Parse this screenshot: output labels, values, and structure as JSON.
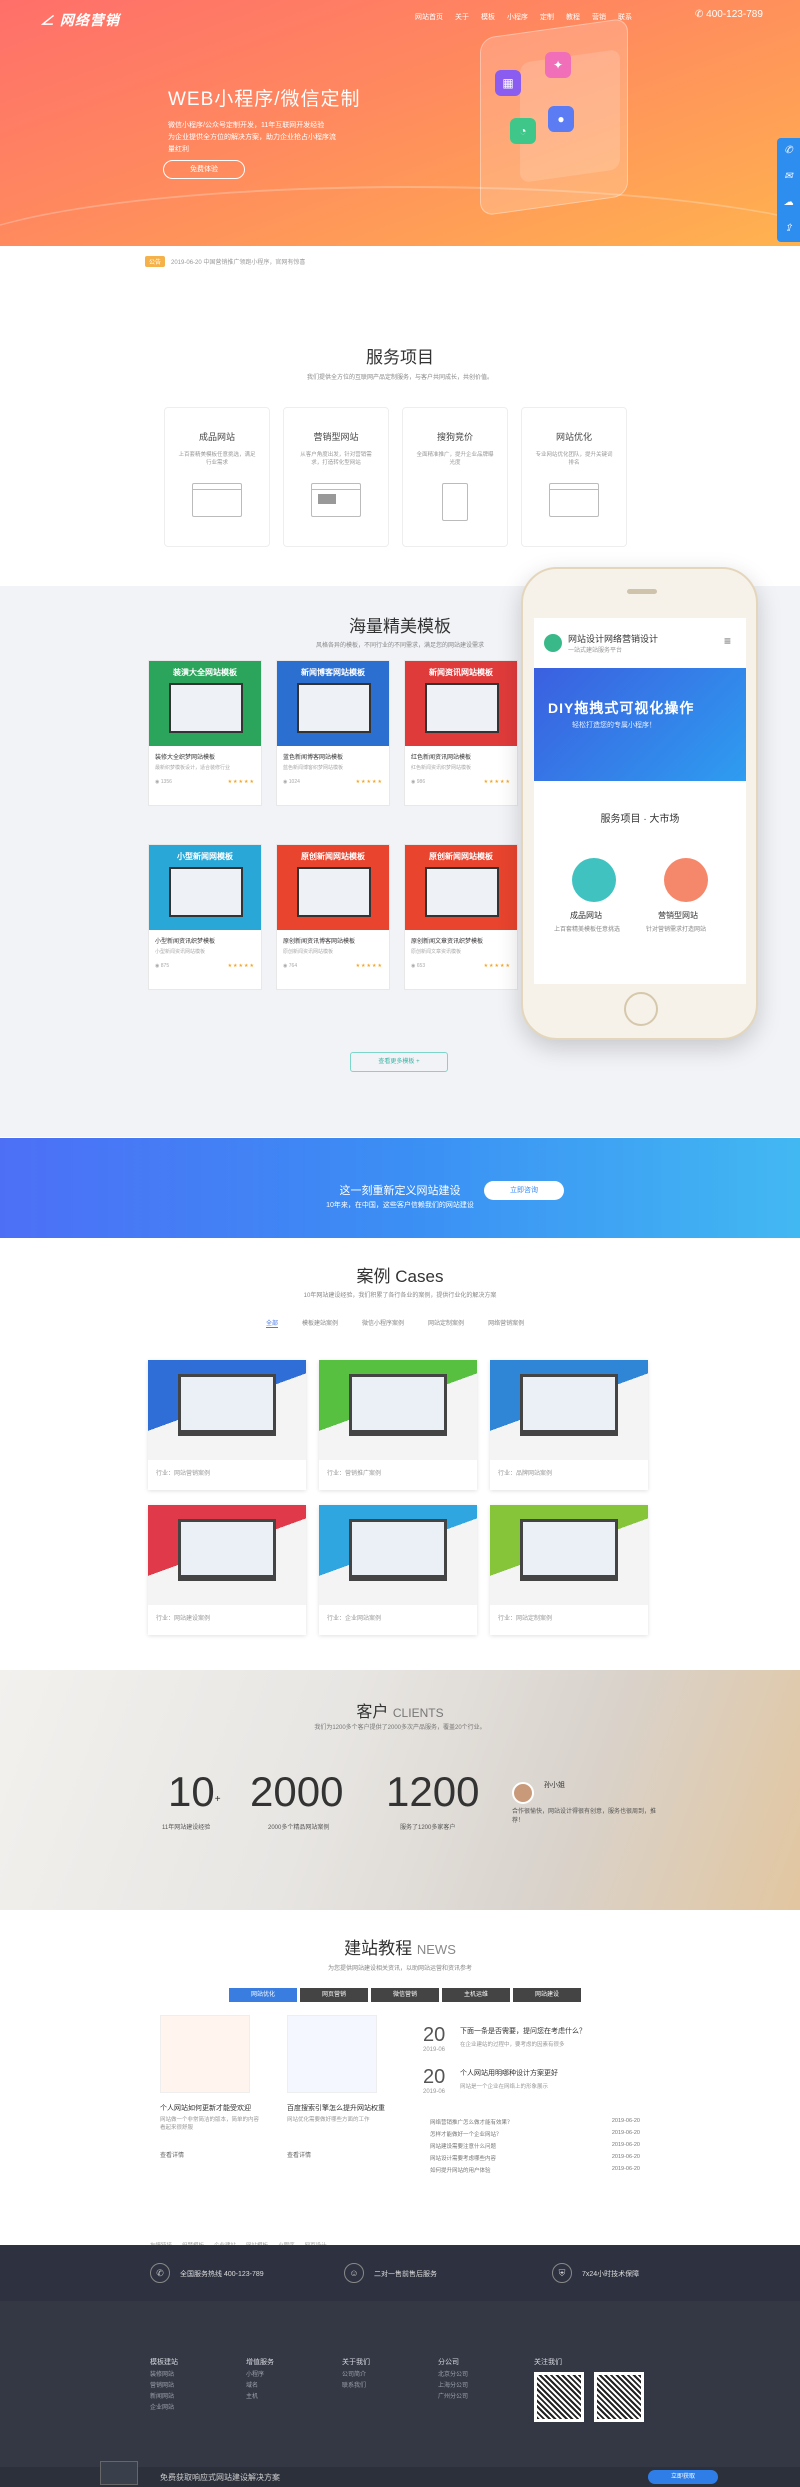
{
  "header": {
    "logo": "网络营销",
    "nav": [
      "网站首页",
      "关于",
      "模板",
      "小程序",
      "定制",
      "教程",
      "营销",
      "联系"
    ],
    "phone": "400-123-789"
  },
  "hero": {
    "title": "WEB小程序/微信定制",
    "desc1": "微信小程序/公众号定制开发，11年互联网开发经验",
    "desc2": "为企业提供全方位的解决方案，助力企业抢占小程序流量红利",
    "button": "免费体验"
  },
  "side_icons": [
    "phone-icon",
    "message-icon",
    "qq-icon",
    "share-icon"
  ],
  "notice": {
    "badge": "公告",
    "text": "2019-06-20  中国营销推广领跑小程序，官网有惊喜"
  },
  "services": {
    "title": "服务项目",
    "subtitle": "我们提供全方位的互联网产品定制服务，与客户共同成长，共创价值。",
    "items": [
      {
        "name": "成品网站",
        "desc": "上百套精美模板任意挑选，满足行业需求"
      },
      {
        "name": "营销型网站",
        "desc": "从客户角度出发，针对营销需求，打造转化型网站"
      },
      {
        "name": "搜狗竞价",
        "desc": "全面精准推广，提升企业品牌曝光度"
      },
      {
        "name": "网站优化",
        "desc": "专业网站优化团队，提升关键词排名"
      }
    ]
  },
  "templates": {
    "title": "海量精美模板",
    "subtitle": "风格各异的模板，不同行业的不同需求，满足您的网站建设需求",
    "more": "查看更多模板",
    "items": [
      {
        "banner": "装潢大全网站模板",
        "name": "装修大全织梦网站模板",
        "desc": "最新织梦模板设计，适合装修行业",
        "views": "1356",
        "color": "#2ca55c"
      },
      {
        "banner": "新闻博客网站模板",
        "name": "蓝色新闻博客网站模板",
        "desc": "蓝色新闻博客织梦网站模板",
        "views": "1024",
        "color": "#2b6fd1"
      },
      {
        "banner": "新闻资讯网站模板",
        "name": "红色新闻资讯网站模板",
        "desc": "红色新闻资讯织梦网站模板",
        "views": "986",
        "color": "#e03b3b"
      },
      {
        "banner": "小型新闻网模板",
        "name": "小型新闻资讯织梦模板",
        "desc": "小型新闻资讯网站模板",
        "views": "875",
        "color": "#29a8d8"
      },
      {
        "banner": "原创新闻网站模板",
        "name": "原创新闻资讯博客网站模板",
        "desc": "原创新闻资讯网站模板",
        "views": "764",
        "color": "#e8442e"
      },
      {
        "banner": "原创新闻网站模板",
        "name": "原创新闻文章资讯织梦模板",
        "desc": "原创新闻文章资讯模板",
        "views": "653",
        "color": "#e8442e"
      }
    ]
  },
  "mobile": {
    "site_title": "网站设计网络营销设计",
    "site_sub": "一站式建站服务平台",
    "banner_title": "DIY拖拽式可视化操作",
    "banner_sub": "轻松打造您的专属小程序！",
    "section": "服务项目 · 大市场",
    "item1": "成品网站",
    "item2": "营销型网站",
    "item1_desc": "上百套精美模板任意挑选",
    "item2_desc": "针对营销需求打造网站"
  },
  "cta": {
    "title": "这一刻重新定义网站建设",
    "sub": "10年来，在中国，这些客户信赖我们的网站建设",
    "button": "立即咨询"
  },
  "cases": {
    "title": "案例",
    "title_en": "Cases",
    "subtitle": "10年网站建设经验，我们积累了各行各业的案例，提供行业化的解决方案",
    "tabs": [
      "全部",
      "模板建站案例",
      "微信小程序案例",
      "网站定制案例",
      "网络营销案例"
    ],
    "items": [
      {
        "label": "行业：网站营销案例",
        "color": "#2f6ed6"
      },
      {
        "label": "行业：营销推广案例",
        "color": "#58c040"
      },
      {
        "label": "行业：品牌网站案例",
        "color": "#2f86d6"
      },
      {
        "label": "行业：网站建设案例",
        "color": "#e03a4a"
      },
      {
        "label": "行业：企业网站案例",
        "color": "#2fa6e0"
      },
      {
        "label": "行业：网站定制案例",
        "color": "#86c43a"
      }
    ]
  },
  "clients": {
    "title": "客户",
    "title_en": "CLIENTS",
    "subtitle": "我们为1200多个客户提供了2000多次产品服务，覆盖20个行业。",
    "stats": [
      {
        "num": "10",
        "sup": "+",
        "label": "11年网站建设经验"
      },
      {
        "num": "2000",
        "sup": "",
        "label": "2000多个精品网站案例"
      },
      {
        "num": "1200",
        "sup": "",
        "label": "服务了1200多家客户"
      }
    ],
    "testimonial_name": "孙小姐",
    "testimonial": "合作很愉快，网站设计得很有创意，服务也很周到，推荐！"
  },
  "news": {
    "title": "建站教程",
    "title_en": "NEWS",
    "subtitle": "为您提供网站建设相关资讯，以助网站运营和资讯参考",
    "tabs": [
      "网站优化",
      "网页营销",
      "微信营销",
      "主机运维",
      "网站建设"
    ],
    "article1": {
      "title": "个人网站如何更新才能受欢迎",
      "desc": "网站做一个非常简洁的版本，简单的内容看起来很舒服",
      "more": "查看详情"
    },
    "article2": {
      "title": "百度搜索引擎怎么提升网站权重",
      "desc": "网站优化需要做好哪些方面的工作",
      "more": "查看详情"
    },
    "feature": [
      {
        "day": "20",
        "date": "2019-06",
        "title": "下面一条是否需要，提问您在考虑什么？",
        "desc": "在企业建站的过程中，要考虑的因素有很多"
      },
      {
        "day": "20",
        "date": "2019-06",
        "title": "个人网站用明哪种设计方案更好",
        "desc": "网站是一个企业在网络上的形象展示"
      }
    ],
    "list": [
      {
        "t": "网络营销推广怎么做才能有效果？",
        "d": "2019-06-20"
      },
      {
        "t": "怎样才能做好一个企业网站？",
        "d": "2019-06-20"
      },
      {
        "t": "网站建设需要注意什么问题",
        "d": "2019-06-20"
      },
      {
        "t": "网站设计需要考虑哪些内容",
        "d": "2019-06-20"
      },
      {
        "t": "如何提升网站的用户体验",
        "d": "2019-06-20"
      }
    ]
  },
  "links": [
    "友情链接",
    "织梦模板",
    "企业建站",
    "网站模板",
    "小程序",
    "网页设计"
  ],
  "footer": {
    "items": [
      "全国服务热线 400-123-789",
      "二对一售前售后服务",
      "7x24小时技术保障"
    ],
    "cols": [
      {
        "h": "模板建站",
        "l": [
          "装修网站",
          "营销网站",
          "新闻网站",
          "企业网站"
        ]
      },
      {
        "h": "增值服务",
        "l": [
          "小程序",
          "域名",
          "主机"
        ]
      },
      {
        "h": "关于我们",
        "l": [
          "公司简介",
          "联系我们"
        ]
      },
      {
        "h": "分公司",
        "l": [
          "北京分公司",
          "上海分公司",
          "广州分公司"
        ]
      }
    ],
    "qr_title": "关注我们",
    "bottom": "免费获取响应式网站建设解决方案",
    "bottom_btn": "立即获取"
  }
}
